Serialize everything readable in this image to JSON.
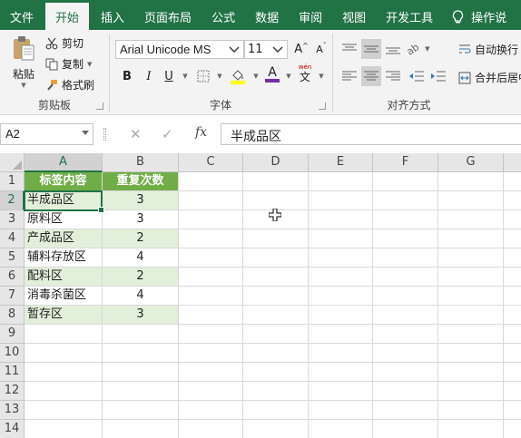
{
  "tabs": [
    "文件",
    "开始",
    "插入",
    "页面布局",
    "公式",
    "数据",
    "审阅",
    "视图",
    "开发工具"
  ],
  "active_tab": "开始",
  "tell_me": "操作说",
  "clipboard": {
    "paste": "粘贴",
    "cut": "剪切",
    "copy": "复制",
    "format_painter": "格式刷",
    "label": "剪贴板"
  },
  "font": {
    "name": "Arial Unicode MS",
    "size": "11",
    "grow": "A",
    "shrink": "A",
    "bold": "B",
    "italic": "I",
    "underline": "U",
    "font_color_letter": "A",
    "phonetic_top": "wén",
    "phonetic_bottom": "文",
    "label": "字体"
  },
  "alignment": {
    "wrap_text": "自动换行",
    "merge_center": "合并后居中",
    "label": "对齐方式"
  },
  "formula_bar": {
    "name_box": "A2",
    "cancel": "✕",
    "enter": "✓",
    "fx": "fx",
    "content": "半成品区"
  },
  "sheet": {
    "columns": [
      "A",
      "B",
      "C",
      "D",
      "E",
      "F",
      "G"
    ],
    "row_numbers": [
      "1",
      "2",
      "3",
      "4",
      "5",
      "6",
      "7",
      "8",
      "9",
      "10",
      "11",
      "12",
      "13",
      "14"
    ],
    "header": [
      "标签内容",
      "重复次数"
    ],
    "rows": [
      [
        "半成品区",
        "3"
      ],
      [
        "原料区",
        "3"
      ],
      [
        "产成品区",
        "2"
      ],
      [
        "辅料存放区",
        "4"
      ],
      [
        "配料区",
        "2"
      ],
      [
        "消毒杀菌区",
        "4"
      ],
      [
        "暂存区",
        "3"
      ]
    ]
  },
  "colors": {
    "excel_green": "#217346",
    "table_header": "#70ad47",
    "table_band": "#e2efda",
    "fill_yellow": "#ffff00",
    "font_red": "#7030a0"
  }
}
